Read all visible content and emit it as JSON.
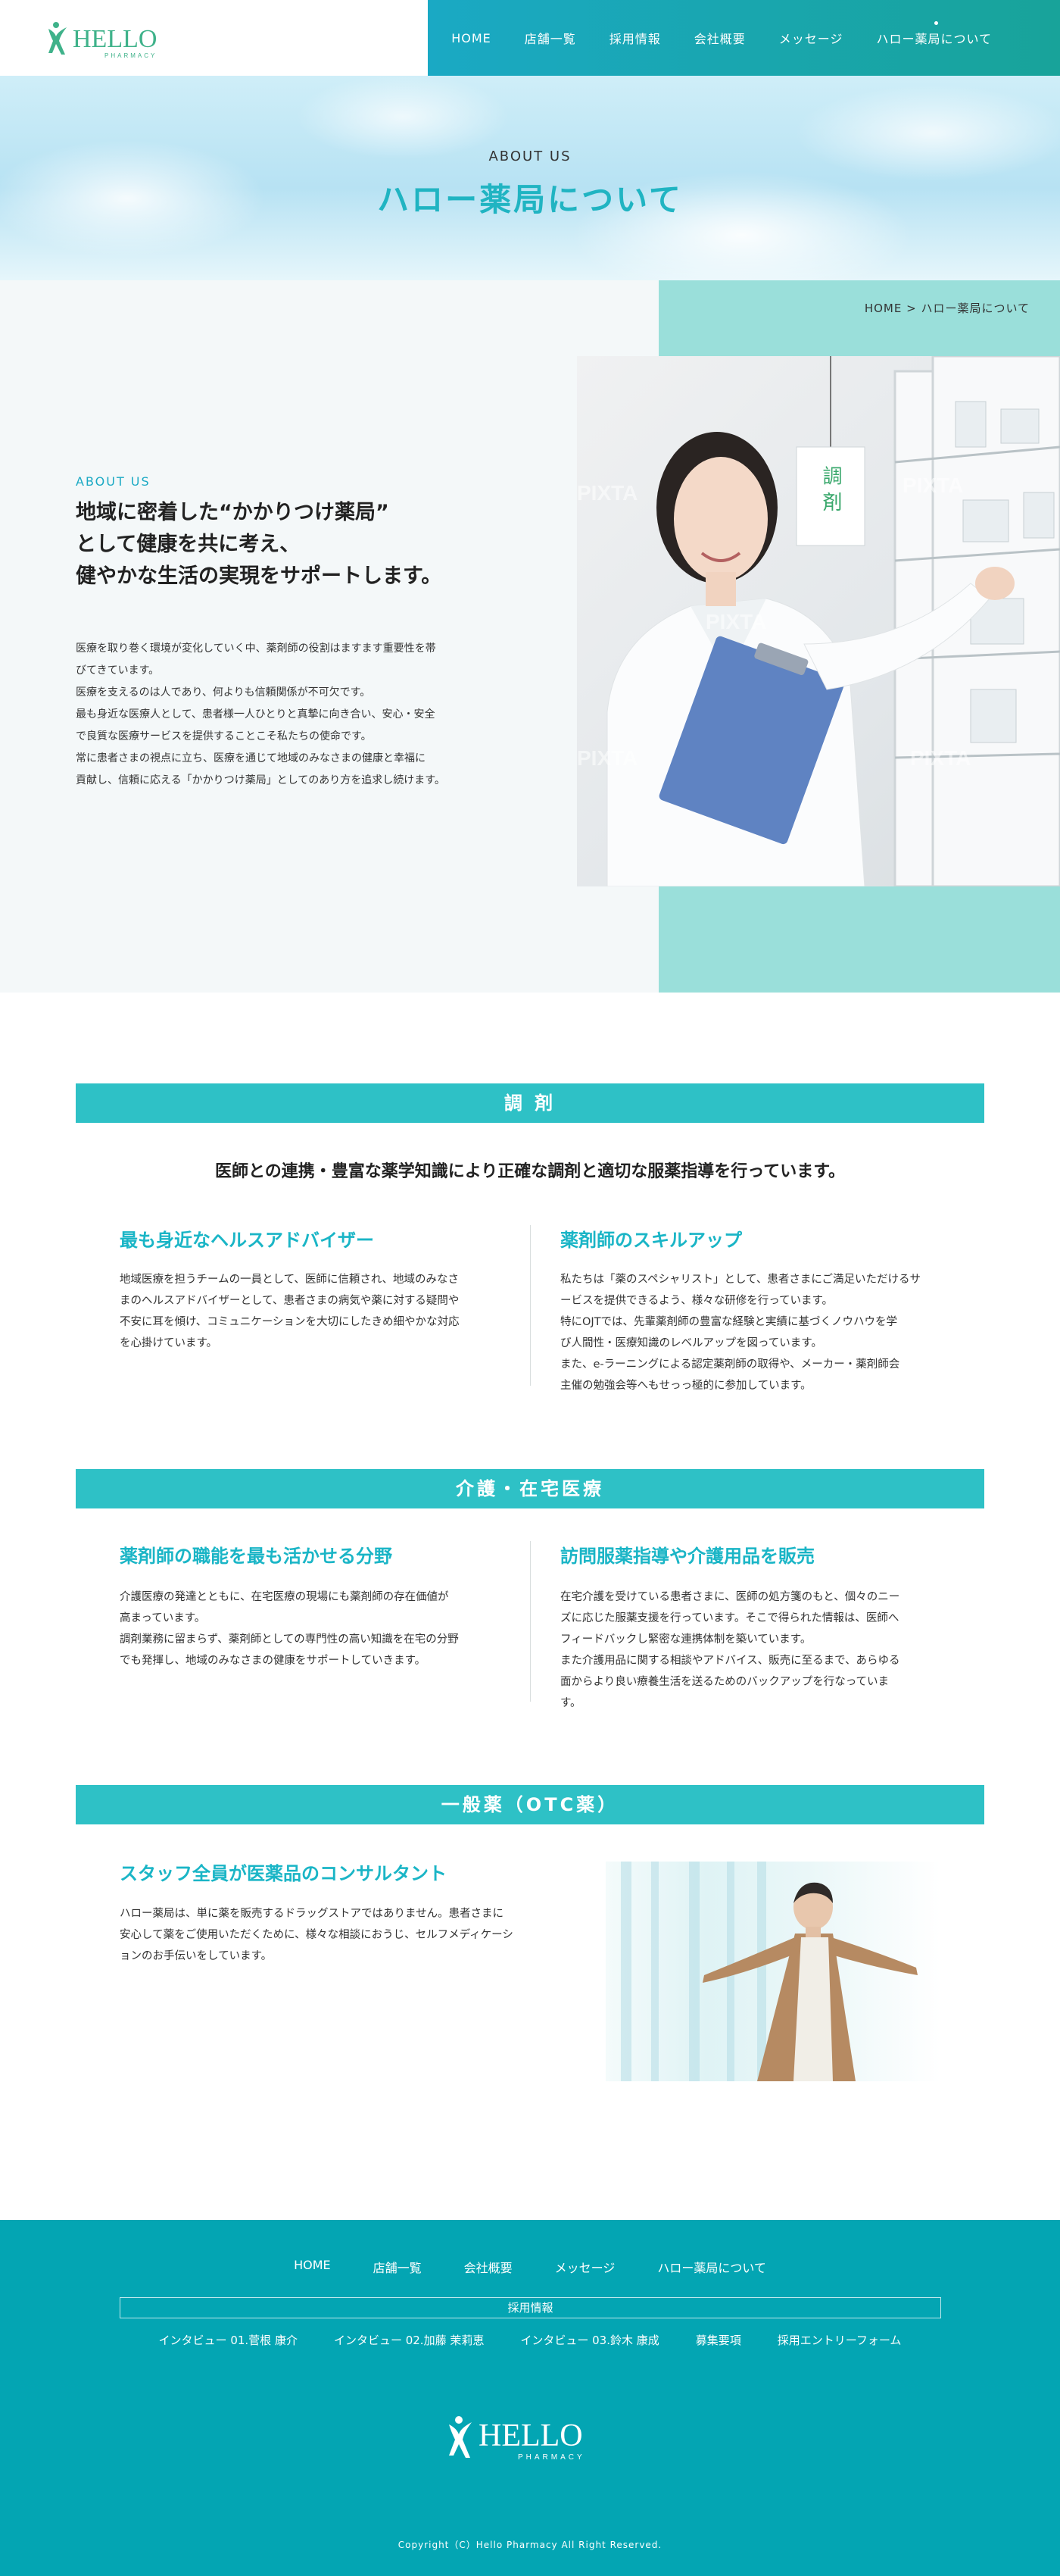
{
  "header": {
    "logo_text": "HELLO",
    "logo_sub": "PHARMACY",
    "nav": [
      "HOME",
      "店舗一覧",
      "採用情報",
      "会社概要",
      "メッセージ",
      "ハロー薬局について"
    ],
    "active_index": 5
  },
  "hero": {
    "subtitle": "ABOUT US",
    "title": "ハロー薬局について"
  },
  "breadcrumb": "HOME > ハロー薬局について",
  "about": {
    "label": "ABOUT US",
    "heading_lines": [
      "地域に密着した“かかりつけ薬局”",
      "として健康を共に考え、",
      "健やかな生活の実現をサポートします。"
    ],
    "body_lines": [
      "医療を取り巻く環境が変化していく中、薬剤師の役割はますます重要性を帯",
      "びてきています。",
      "医療を支えるのは人であり、何よりも信頼関係が不可欠です。",
      "最も身近な医療人として、患者様一人ひとりと真摯に向き合い、安心・安全",
      "で良質な医療サービスを提供することこそ私たちの使命です。",
      "常に患者さまの視点に立ち、医療を通じて地域のみなさまの健康と幸福に",
      "貢献し、信頼に応える「かかりつけ薬局」としてのあり方を追求し続けます。"
    ],
    "photo_sign": "調 剤",
    "watermark": "PIXTA"
  },
  "dispensing": {
    "title": "調 剤",
    "lead": "医師との連携・豊富な薬学知識により正確な調剤と適切な服薬指導を行っています。",
    "col1_title": "最も身近なヘルスアドバイザー",
    "col1_lines": [
      "地域医療を担うチームの一員として、医師に信頼され、地域のみなさ",
      "まのヘルスアドバイザーとして、患者さまの病気や薬に対する疑問や",
      "不安に耳を傾け、コミュニケーションを大切にしたきめ細やかな対応",
      "を心掛けています。"
    ],
    "col2_title": "薬剤師のスキルアップ",
    "col2_lines": [
      "私たちは「薬のスペシャリスト」として、患者さまにご満足いただけるサ",
      "ービスを提供できるよう、様々な研修を行っています。",
      "特にOJTでは、先輩薬剤師の豊富な経験と実績に基づくノウハウを学",
      "び人間性・医療知識のレベルアップを図っています。",
      "また、e-ラーニングによる認定薬剤師の取得や、メーカー・薬剤師会",
      "主催の勉強会等へもせっっ極的に参加しています。"
    ]
  },
  "care": {
    "title": "介護・在宅医療",
    "col1_title": "薬剤師の職能を最も活かせる分野",
    "col1_lines": [
      "介護医療の発達とともに、在宅医療の現場にも薬剤師の存在価値が",
      "高まっています。",
      "調剤業務に留まらず、薬剤師としての専門性の高い知識を在宅の分野",
      "でも発揮し、地域のみなさまの健康をサポートしていきます。"
    ],
    "col2_title": "訪問服薬指導や介護用品を販売",
    "col2_lines": [
      "在宅介護を受けている患者さまに、医師の処方箋のもと、個々のニー",
      "ズに応じた服薬支援を行っています。そこで得られた情報は、医師へ",
      "フィードバックし緊密な連携体制を築いています。",
      "また介護用品に関する相談やアドバイス、販売に至るまで、あらゆる",
      "面からより良い療養生活を送るためのバックアップを行なっていま",
      "す。"
    ]
  },
  "otc": {
    "title": "一般薬（OTC薬）",
    "col_title": "スタッフ全員が医薬品のコンサルタント",
    "col_lines": [
      "ハロー薬局は、単に薬を販売するドラッグストアではありません。患者さまに",
      "安心して薬をご使用いただくために、様々な相談におうじ、セルフメディケーシ",
      "ョンのお手伝いをしています。"
    ]
  },
  "footer": {
    "nav": [
      "HOME",
      "店舗一覧",
      "会社概要",
      "メッセージ",
      "ハロー薬局について"
    ],
    "recruit_label": "採用情報",
    "recruit_links": [
      "インタビュー 01.菅根 康介",
      "インタビュー 02.加藤 茉莉恵",
      "インタビュー 03.鈴木 康成",
      "募集要項",
      "採用エントリーフォーム"
    ],
    "logo_text": "HELLO",
    "logo_sub": "PHARMACY",
    "copyright": "Copyright（C）Hello Pharmacy All Right Reserved."
  },
  "colors": {
    "accent": "#1aa9c4",
    "band": "#2ec1c6",
    "footer": "#03a5b3",
    "about_teal": "#9adfda",
    "logo_green": "#3fb28a"
  }
}
